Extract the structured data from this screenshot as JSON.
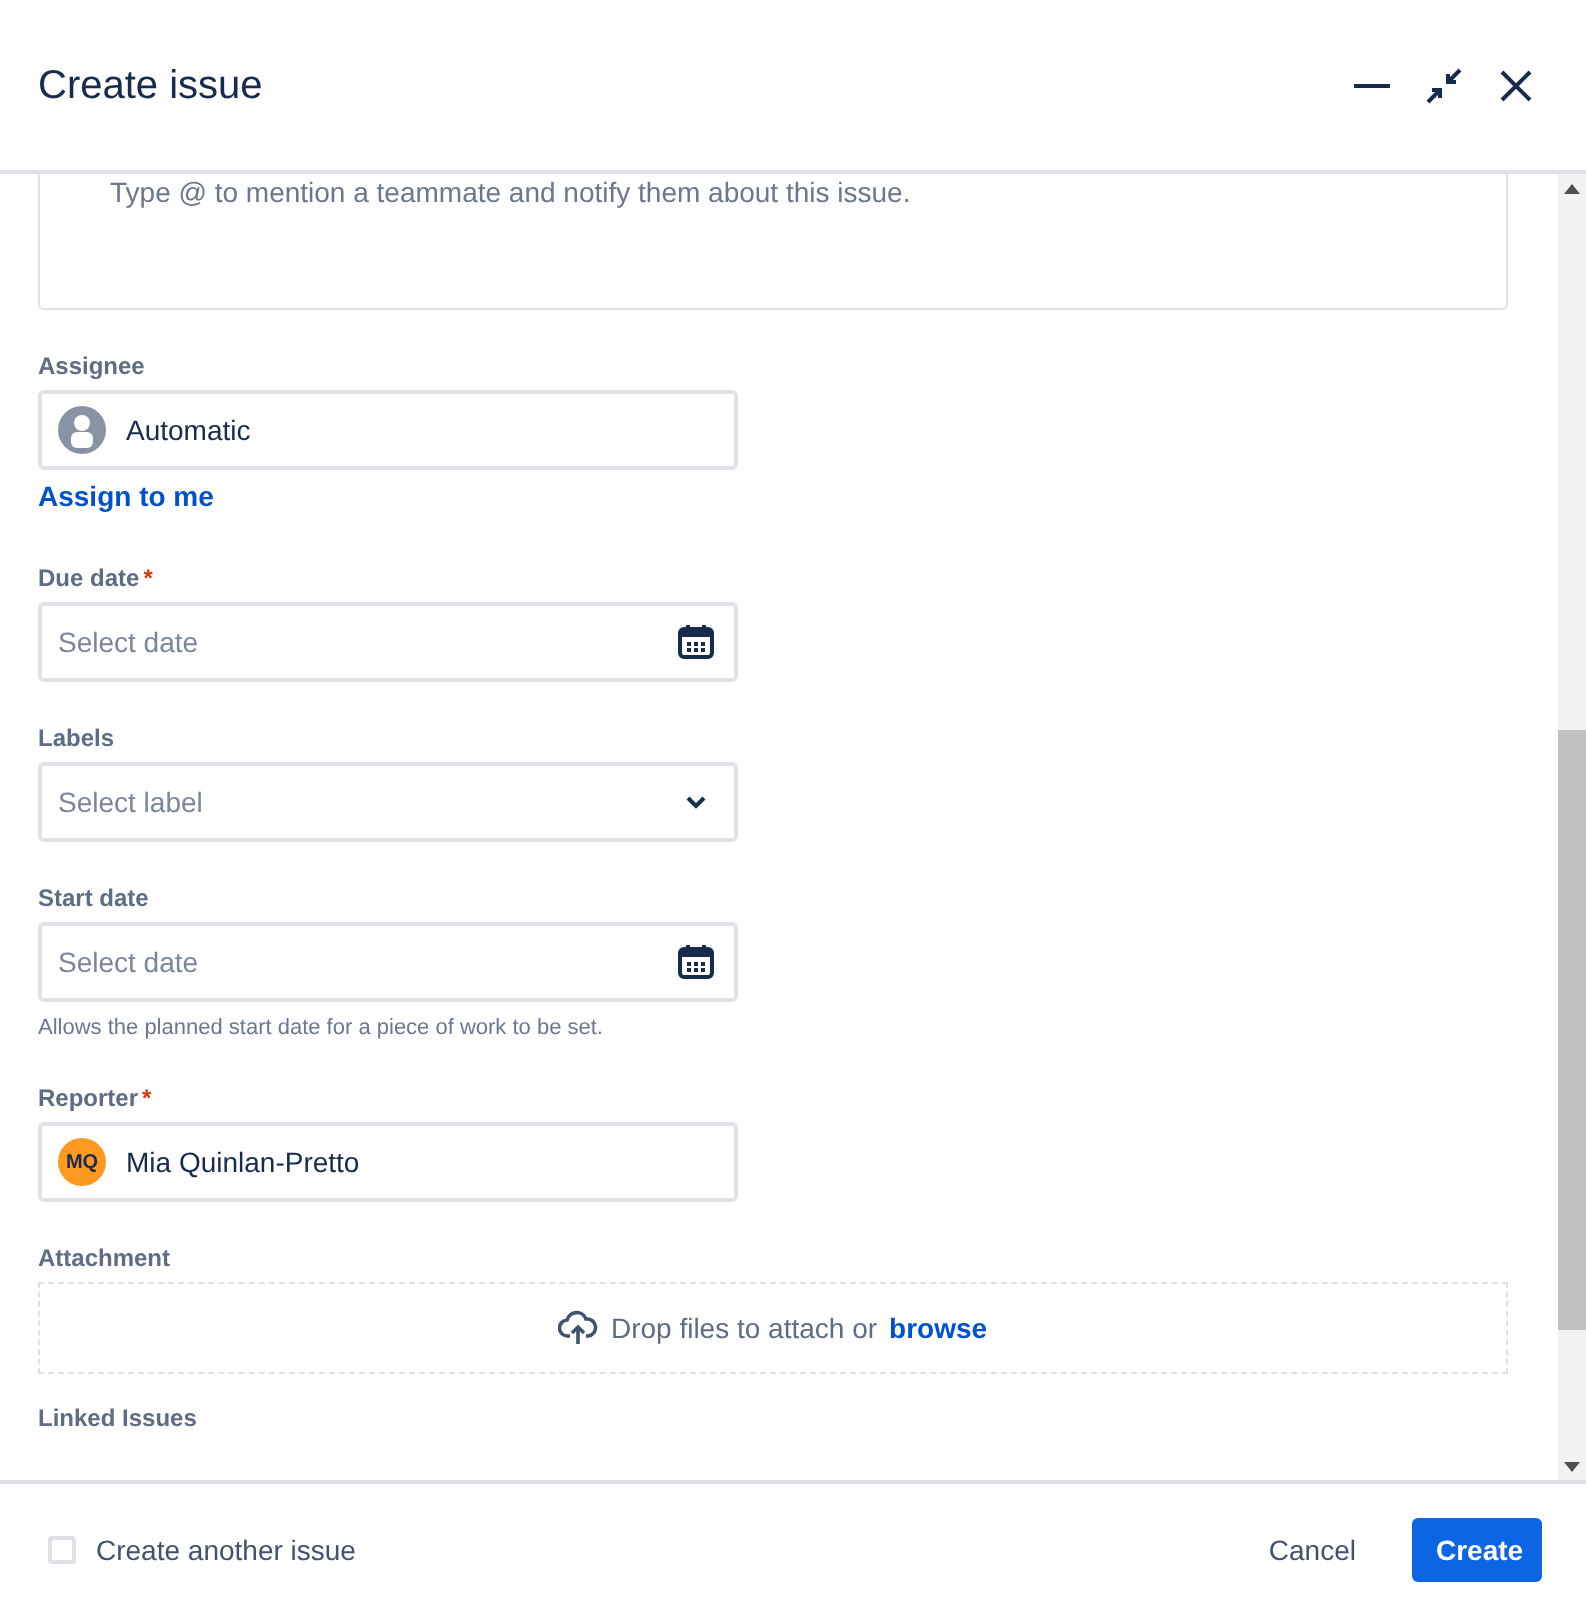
{
  "header": {
    "title": "Create issue"
  },
  "description": {
    "placeholder": "Type @ to mention a teammate and notify them about this issue."
  },
  "required_mark": "*",
  "fields": [
    {
      "kind": "user",
      "label": "Assignee",
      "required": false,
      "value": "Automatic",
      "link": "Assign to me"
    },
    {
      "kind": "date",
      "label": "Due date",
      "required": true,
      "placeholder": "Select date"
    },
    {
      "kind": "select",
      "label": "Labels",
      "required": false,
      "placeholder": "Select label"
    },
    {
      "kind": "date",
      "label": "Start date",
      "required": false,
      "placeholder": "Select date",
      "help": "Allows the planned start date for a piece of work to be set."
    },
    {
      "kind": "user",
      "label": "Reporter",
      "required": true,
      "value": "Mia Quinlan-Pretto",
      "initials": "MQ"
    },
    {
      "kind": "upload",
      "label": "Attachment",
      "required": false,
      "text": "Drop files to attach or",
      "link": "browse"
    },
    {
      "kind": "heading",
      "label": "Linked Issues",
      "required": false
    }
  ],
  "footer": {
    "checkbox": {
      "label": "Create another issue",
      "checked": false
    },
    "buttons": [
      {
        "kind": "subtle",
        "label": "Cancel"
      },
      {
        "kind": "primary",
        "label": "Create"
      }
    ]
  }
}
